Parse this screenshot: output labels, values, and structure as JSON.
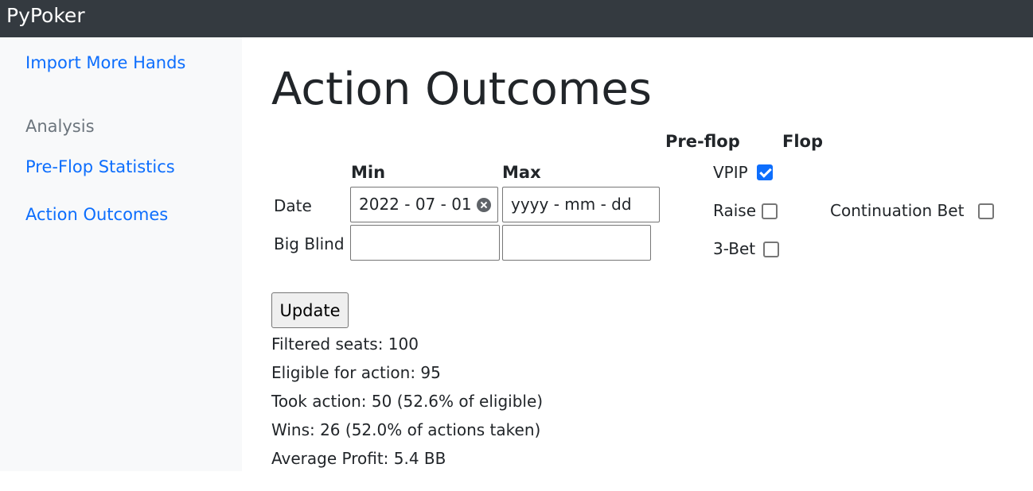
{
  "app": {
    "brand": "PyPoker"
  },
  "sidebar": {
    "import_link": "Import More Hands",
    "section_heading": "Analysis",
    "items": [
      {
        "label": "Pre-Flop Statistics"
      },
      {
        "label": "Action Outcomes"
      }
    ]
  },
  "main": {
    "title": "Action Outcomes",
    "filters": {
      "min_header": "Min",
      "max_header": "Max",
      "date_label": "Date",
      "date_min_value": "2022 - 07 - 01",
      "date_max_value": "yyyy - mm - dd",
      "big_blind_label": "Big Blind",
      "big_blind_min_value": "",
      "big_blind_max_value": ""
    },
    "actions": {
      "preflop_header": "Pre-flop",
      "flop_header": "Flop",
      "preflop": [
        {
          "label": "VPIP",
          "checked": true
        },
        {
          "label": "Raise",
          "checked": false
        },
        {
          "label": "3-Bet",
          "checked": false
        }
      ],
      "flop": [
        {
          "label": "Continuation Bet",
          "checked": false
        }
      ]
    },
    "update_button": "Update",
    "stats": [
      "Filtered seats: 100",
      "Eligible for action: 95",
      "Took action: 50 (52.6% of eligible)",
      "Wins: 26 (52.0% of actions taken)",
      "Average Profit: 5.4 BB"
    ]
  },
  "colors": {
    "navbar_bg": "#343a40",
    "link": "#0d6efd",
    "sidebar_bg": "#f8f9fa",
    "checkbox_checked": "#0d6efd"
  }
}
